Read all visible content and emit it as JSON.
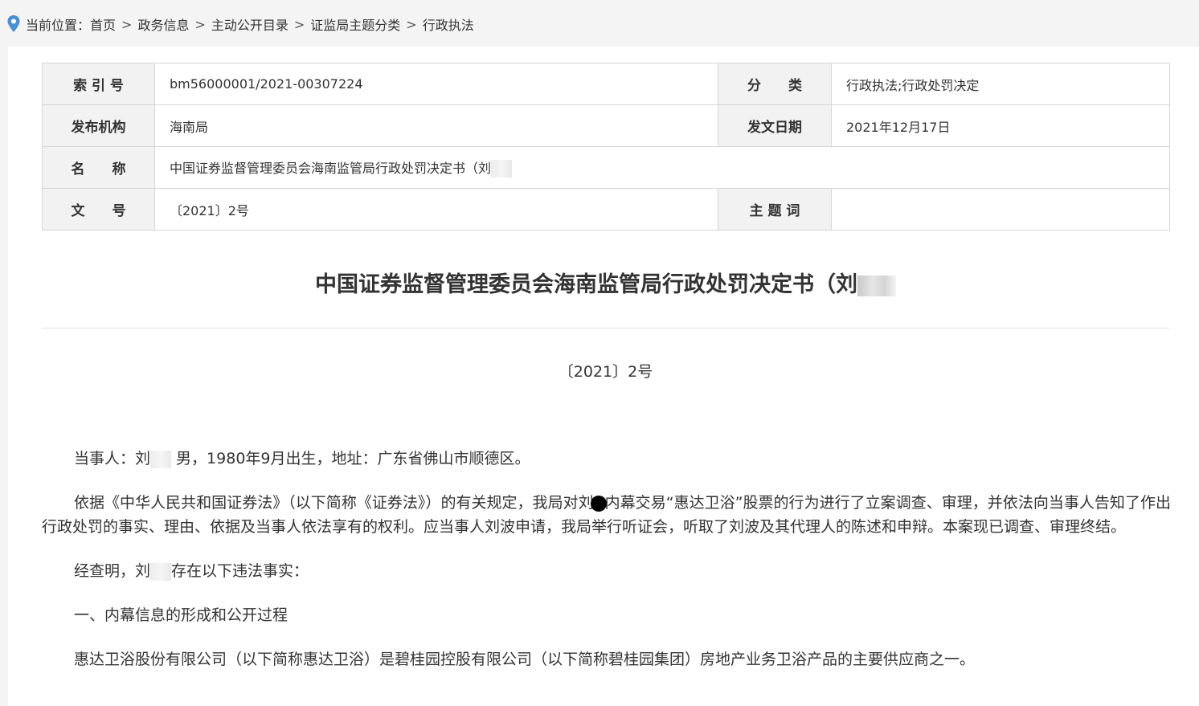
{
  "breadcrumb": {
    "prefix": "当前位置：",
    "items": [
      "首页",
      "政务信息",
      "主动公开目录",
      "证监局主题分类",
      "行政执法"
    ],
    "separator": ">"
  },
  "meta": {
    "index_label": "索 引 号",
    "index_value": "bm56000001/2021-00307224",
    "category_label": "分　　类",
    "category_value": "行政执法;行政处罚决定",
    "publisher_label": "发布机构",
    "publisher_value": "海南局",
    "date_label": "发文日期",
    "date_value": "2021年12月17日",
    "name_label": "名　　称",
    "name_value": "中国证券监督管理委员会海南监管局行政处罚决定书（刘",
    "docno_label": "文　　号",
    "docno_value": "〔2021〕2号",
    "keywords_label": "主 题 词",
    "keywords_value": ""
  },
  "title": "中国证券监督管理委员会海南监管局行政处罚决定书（刘",
  "doc_number": "〔2021〕2号",
  "paragraphs": {
    "p1_a": "当事人：刘",
    "p1_b": " 男，1980年9月出生，地址：广东省佛山市顺德区。",
    "p2_a": "依据《中华人民共和国证券法》（以下简称《证券法》）的有关规定，我局对刘",
    "p2_b": "内幕交易“惠达卫浴”股票的行为进行了立案调查、审理，并依法向当事人告知了作出行政处罚的事实、理由、依据及当事人依法享有的权利。应当事人刘波申请，我局举行听证会，听取了刘波及其代理人的陈述和申辩。本案现已调查、审理终结。",
    "p3_a": "经查明，刘",
    "p3_b": "存在以下违法事实：",
    "p4": "一、内幕信息的形成和公开过程",
    "p5": "惠达卫浴股份有限公司（以下简称惠达卫浴）是碧桂园控股有限公司（以下简称碧桂园集团）房地产业务卫浴产品的主要供应商之一。"
  },
  "colors": {
    "pin": "#4a8fd6",
    "label_bg": "#f2f2f2",
    "border": "#d6d6d6"
  }
}
